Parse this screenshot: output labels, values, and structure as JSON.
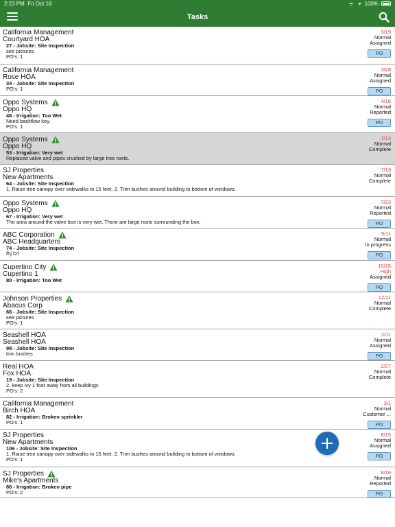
{
  "status_bar": {
    "time": "2:23 PM",
    "date": "Fri Oct 18",
    "battery": "100%"
  },
  "nav": {
    "title": "Tasks"
  },
  "po_label": "PO",
  "tasks": [
    {
      "company": "California Management",
      "site": "Courtyard HOA",
      "warn": false,
      "task": "27 - Jobsite: Site Inspection",
      "note": "see pictures",
      "pos": "PO's:  1",
      "date": "3/19",
      "priority": "Normal",
      "status": "Assigned",
      "po": true
    },
    {
      "company": "California Management",
      "site": "Rose HOA",
      "warn": false,
      "task": "34 - Jobsite: Site Inspection",
      "note": "",
      "pos": "PO's:  1",
      "date": "3/28",
      "priority": "Normal",
      "status": "Assigned",
      "po": true
    },
    {
      "company": "Oppo Systems",
      "site": "Oppo HQ",
      "warn": true,
      "task": "48 - Irrigation: Too Wet",
      "note": "Need backflow key.",
      "pos": "PO's:  1",
      "date": "4/16",
      "priority": "Normal",
      "status": "Reported",
      "po": true
    },
    {
      "company": "Oppo Systems",
      "site": "Oppo HQ",
      "warn": true,
      "task": "53 - Irrigation: Very wet",
      "note": "Replaced valve and pipes crushed by large tree roots.",
      "pos": "",
      "date": "7/13",
      "priority": "Normal",
      "status": "Complete",
      "po": false
    },
    {
      "company": "SJ Properties",
      "site": "New Apartments",
      "warn": false,
      "task": "64 - Jobsite: Site Inspection",
      "note": "1.  Raise tree canopy over sidewalks to 15 feet.  2.  Trim bushes around building to bottom of windows.",
      "pos": "",
      "date": "7/13",
      "priority": "Normal",
      "status": "Complete",
      "po": false
    },
    {
      "company": "Oppo Systems",
      "site": "Oppo HQ",
      "warn": true,
      "task": "67 - Irrigation: Very wet",
      "note": "The area around the valve box is very wet.  There are large roots surrounding the box.",
      "pos": "",
      "date": "7/23",
      "priority": "Normal",
      "status": "Reported",
      "po": true
    },
    {
      "company": "ABC Corporation",
      "site": "ABC Headquarters",
      "warn": true,
      "task": "74 - Jobsite: Site Inspection",
      "note": "fhj f2f",
      "pos": "",
      "date": "9/11",
      "priority": "Normal",
      "status": "In progress",
      "po": true
    },
    {
      "company": "Cupertino City",
      "site": "Cupertino 1",
      "warn": true,
      "task": "80 - Irrigation: Too Wet",
      "note": "",
      "pos": "",
      "date": "10/25",
      "priority": "High",
      "status": "Assigned",
      "po": true
    },
    {
      "company": "Johnson Properties",
      "site": "Abacus Corp",
      "warn": true,
      "task": "66 - Jobsite: Site Inspection",
      "note": "see pictures",
      "pos": "PO's:  1",
      "date": "12/11",
      "priority": "Normal",
      "status": "Complete",
      "po": false
    },
    {
      "company": "Seashell  HOA",
      "site": "Seashell HOA",
      "warn": false,
      "task": "98 - Jobsite: Site Inspection",
      "note": "trim bushes",
      "pos": "",
      "date": "2/11",
      "priority": "Normal",
      "status": "Assigned",
      "po": true
    },
    {
      "company": "Real HOA",
      "site": "Fox HOA",
      "warn": false,
      "task": "19 - Jobsite: Site Inspection",
      "note": "2.  keep ivy 1 foot away from all buildings",
      "pos": "PO's:  2",
      "date": "2/27",
      "priority": "Normal",
      "status": "Complete",
      "po": false
    },
    {
      "company": "California Management",
      "site": "Birch HOA",
      "warn": false,
      "task": "82 - Irrigation: Broken sprinkler",
      "note": "",
      "pos": "PO's:  1",
      "date": "3/1",
      "priority": "Normal",
      "status": "Customer ...",
      "po": true
    },
    {
      "company": "SJ Properties",
      "site": "New Apartments",
      "warn": false,
      "task": "106 - Jobsite: Site Inspection",
      "note": "1.  Raise tree canopy over sidewalks to 15 feet.  2.  Trim bushes around building to bottom of windows.",
      "pos": "PO's:  1",
      "date": "8/15",
      "priority": "Normal",
      "status": "Assigned",
      "po": true
    },
    {
      "company": "SJ Properties",
      "site": "Mike's Apartments",
      "warn": true,
      "task": "86 - Irrigation: Broken pipe",
      "note": "",
      "pos": "PO's:  2",
      "date": "8/16",
      "priority": "Normal",
      "status": "Reported",
      "po": true
    }
  ]
}
